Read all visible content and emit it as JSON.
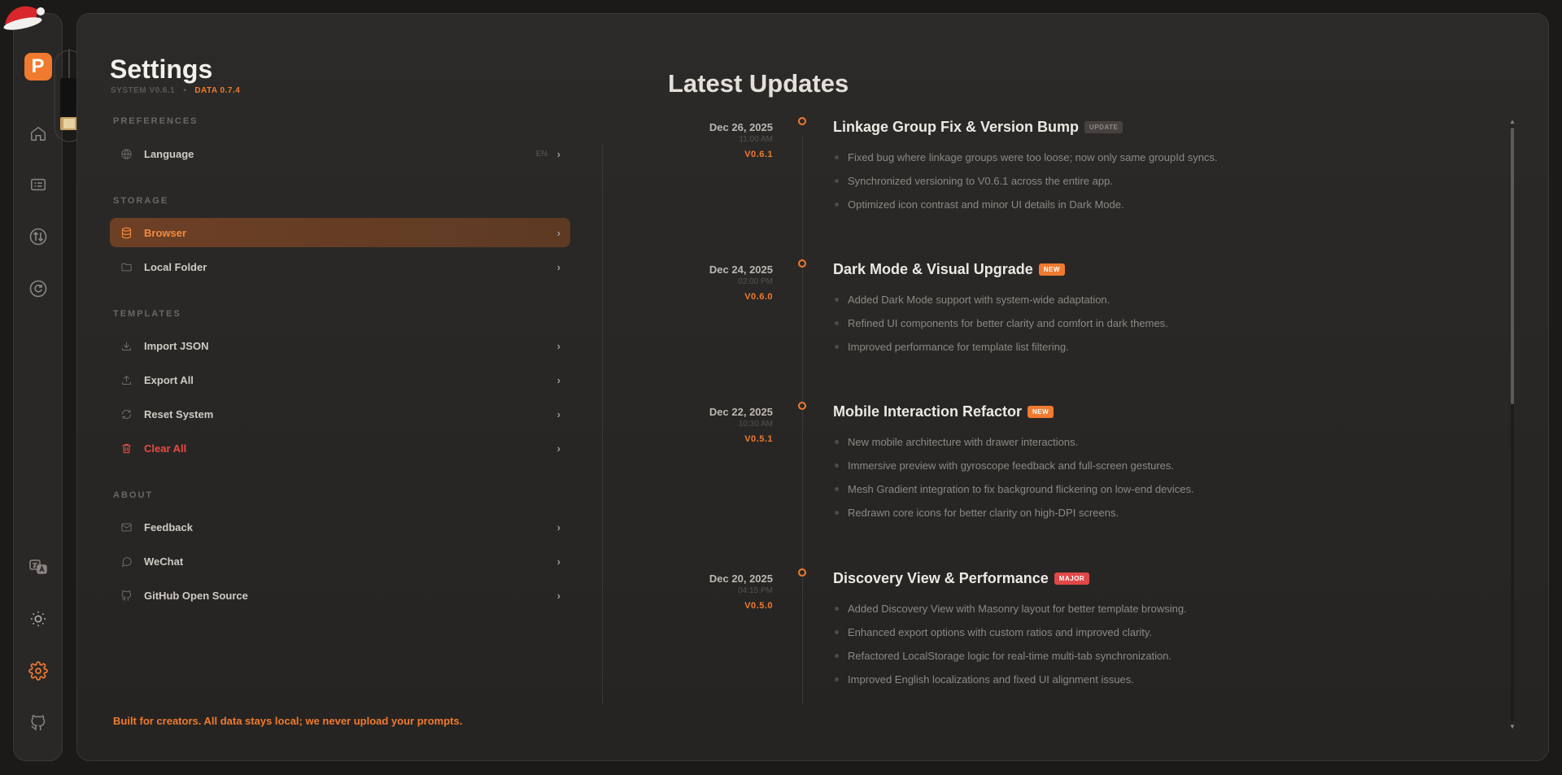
{
  "sidebar": {
    "logo_letter": "P",
    "items": [
      {
        "icon": "home-icon"
      },
      {
        "icon": "list-icon"
      },
      {
        "icon": "sort-icon"
      },
      {
        "icon": "refresh-icon"
      }
    ],
    "bottom_items": [
      {
        "icon": "translate-icon"
      },
      {
        "icon": "sun-icon"
      },
      {
        "icon": "gear-icon"
      },
      {
        "icon": "github-icon"
      }
    ],
    "accent": "#f07a2f"
  },
  "settings": {
    "title": "Settings",
    "system_version": "SYSTEM V0.6.1",
    "separator": "•",
    "data_version": "DATA 0.7.4",
    "sections": {
      "preferences": "PREFERENCES",
      "storage": "STORAGE",
      "templates": "TEMPLATES",
      "about": "ABOUT"
    },
    "language": {
      "label": "Language",
      "value": "EN"
    },
    "browser": {
      "label": "Browser"
    },
    "local_folder": {
      "label": "Local Folder"
    },
    "import_json": {
      "label": "Import JSON"
    },
    "export_all": {
      "label": "Export All"
    },
    "reset_system": {
      "label": "Reset System"
    },
    "clear_all": {
      "label": "Clear All"
    },
    "feedback": {
      "label": "Feedback"
    },
    "wechat": {
      "label": "WeChat"
    },
    "github": {
      "label": "GitHub Open Source"
    },
    "footer": "Built for creators. All data stays local; we never upload your prompts."
  },
  "updates": {
    "title": "Latest Updates",
    "entries": [
      {
        "date": "Dec 26, 2025",
        "time": "11:00 AM",
        "version": "V0.6.1",
        "title": "Linkage Group Fix & Version Bump",
        "tag": "UPDATE",
        "items": [
          "Fixed bug where linkage groups were too loose; now only same groupId syncs.",
          "Synchronized versioning to V0.6.1 across the entire app.",
          "Optimized icon contrast and minor UI details in Dark Mode."
        ]
      },
      {
        "date": "Dec 24, 2025",
        "time": "02:00 PM",
        "version": "V0.6.0",
        "title": "Dark Mode & Visual Upgrade",
        "tag": "NEW",
        "items": [
          "Added Dark Mode support with system-wide adaptation.",
          "Refined UI components for better clarity and comfort in dark themes.",
          "Improved performance for template list filtering."
        ]
      },
      {
        "date": "Dec 22, 2025",
        "time": "10:30 AM",
        "version": "V0.5.1",
        "title": "Mobile Interaction Refactor",
        "tag": "NEW",
        "items": [
          "New mobile architecture with drawer interactions.",
          "Immersive preview with gyroscope feedback and full-screen gestures.",
          "Mesh Gradient integration to fix background flickering on low-end devices.",
          "Redrawn core icons for better clarity on high-DPI screens."
        ]
      },
      {
        "date": "Dec 20, 2025",
        "time": "04:15 PM",
        "version": "V0.5.0",
        "title": "Discovery View & Performance",
        "tag": "MAJOR",
        "items": [
          "Added Discovery View with Masonry layout for better template browsing.",
          "Enhanced export options with custom ratios and improved clarity.",
          "Refactored LocalStorage logic for real-time multi-tab synchronization.",
          "Improved English localizations and fixed UI alignment issues."
        ]
      }
    ]
  }
}
